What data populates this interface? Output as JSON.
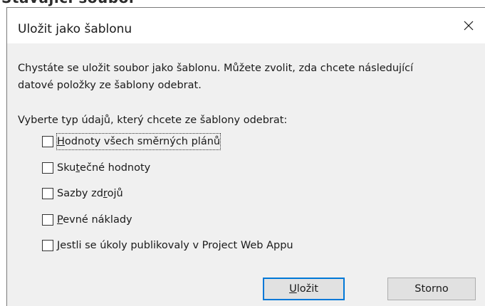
{
  "background": {
    "partial_text": "Stávající soubor"
  },
  "dialog": {
    "title": "Uložit jako šablonu",
    "close_icon": "close-icon",
    "description": [
      "Chystáte se uložit soubor jako šablonu. Můžete zvolit, zda chcete následující",
      "datové položky ze šablony odebrat."
    ],
    "prompt": "Vyberte typ údajů, který chcete ze šablony odebrat:",
    "options": [
      {
        "before": "",
        "mnemonic": "H",
        "after": "odnoty všech směrných plánů",
        "checked": false,
        "focused": true
      },
      {
        "before": "Sku",
        "mnemonic": "t",
        "after": "ečné hodnoty",
        "checked": false,
        "focused": false
      },
      {
        "before": "Sazby zd",
        "mnemonic": "r",
        "after": "ojů",
        "checked": false,
        "focused": false
      },
      {
        "before": "",
        "mnemonic": "P",
        "after": "evné náklady",
        "checked": false,
        "focused": false
      },
      {
        "before": "",
        "mnemonic": "J",
        "after": "estli se úkoly publikovaly v Project Web Appu",
        "checked": false,
        "focused": false
      }
    ],
    "buttons": {
      "save": {
        "mnemonic": "U",
        "rest": "ložit"
      },
      "cancel": "Storno"
    },
    "colors": {
      "dialog_bg": "#f0f0f0",
      "titlebar_bg": "#ffffff",
      "primary_border": "#0078d7",
      "button_bg": "#e1e1e1"
    }
  }
}
